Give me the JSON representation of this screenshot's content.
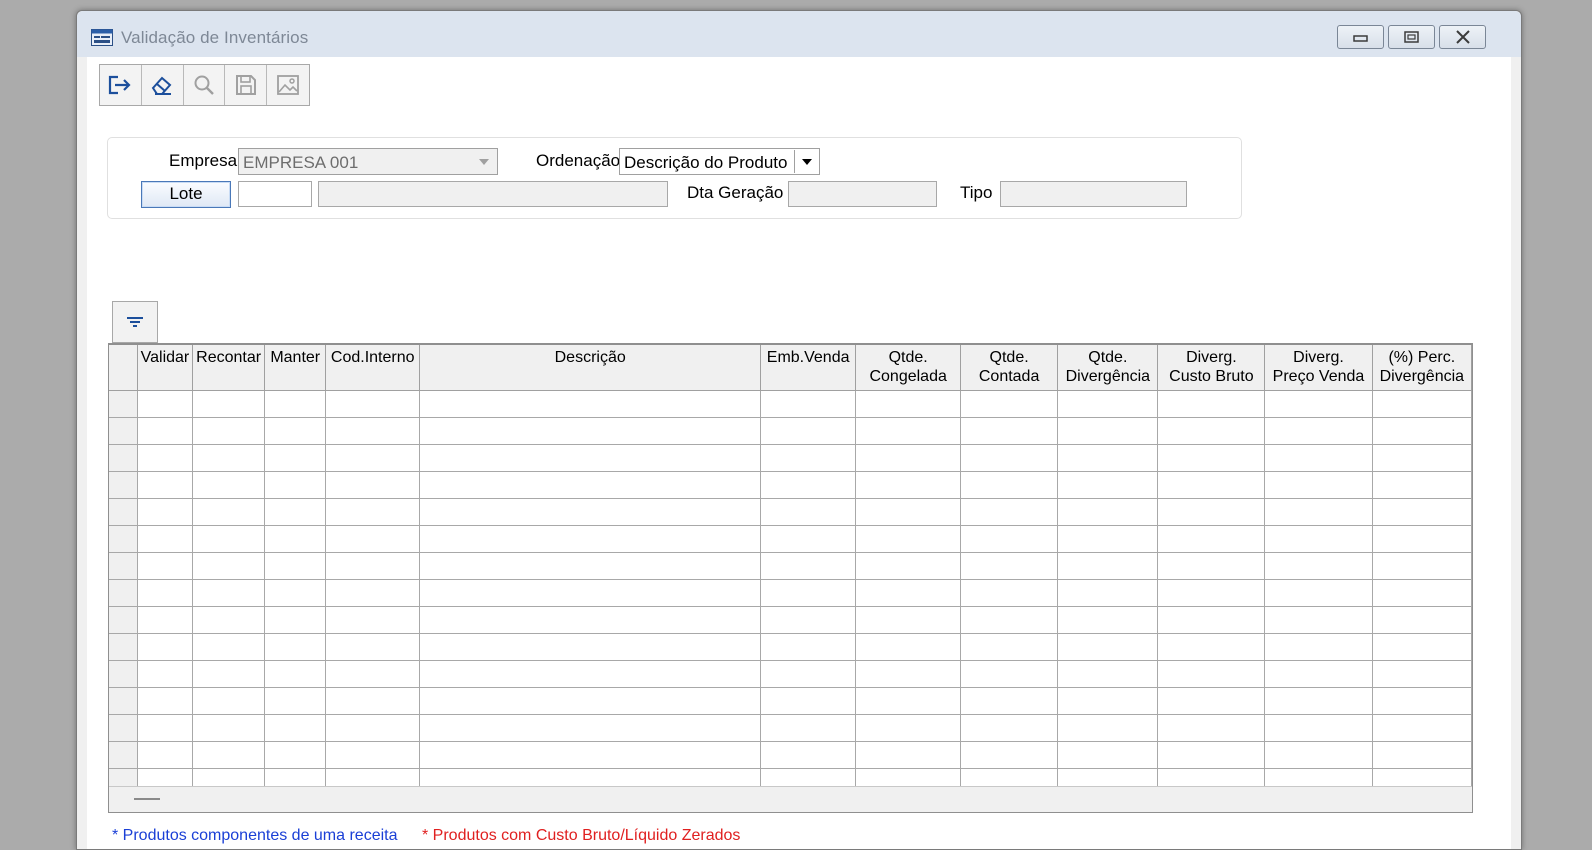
{
  "window": {
    "title": "Validação de Inventários",
    "icon": "form-window-icon",
    "controls": [
      "minimize-icon",
      "restore-icon",
      "close-icon"
    ]
  },
  "toolbar": {
    "buttons": [
      {
        "name": "exit-button",
        "icon": "exit-icon",
        "enabled": true
      },
      {
        "name": "clear-button",
        "icon": "eraser-icon",
        "enabled": true
      },
      {
        "name": "search-button",
        "icon": "search-icon",
        "enabled": false
      },
      {
        "name": "save-button",
        "icon": "save-icon",
        "enabled": false
      },
      {
        "name": "image-button",
        "icon": "image-icon",
        "enabled": false
      }
    ]
  },
  "filters": {
    "empresa_label": "Empresa",
    "empresa_value": "EMPRESA 001",
    "ordenacao_label": "Ordenação",
    "ordenacao_value": "Descrição do Produto",
    "lote_button": "Lote",
    "lote_code": "",
    "lote_description": "",
    "dta_geracao_label": "Dta Geração",
    "dta_geracao_value": "",
    "tipo_label": "Tipo",
    "tipo_value": ""
  },
  "grid": {
    "filter_icon": "filter-icon",
    "columns": [
      {
        "line1": "",
        "line2": ""
      },
      {
        "line1": "Validar",
        "line2": ""
      },
      {
        "line1": "Recontar",
        "line2": ""
      },
      {
        "line1": "Manter",
        "line2": ""
      },
      {
        "line1": "Cod.Interno",
        "line2": ""
      },
      {
        "line1": "Descrição",
        "line2": ""
      },
      {
        "line1": "Emb.Venda",
        "line2": ""
      },
      {
        "line1": "Qtde.",
        "line2": "Congelada"
      },
      {
        "line1": "Qtde.",
        "line2": "Contada"
      },
      {
        "line1": "Qtde.",
        "line2": "Divergência"
      },
      {
        "line1": "Diverg.",
        "line2": "Custo Bruto"
      },
      {
        "line1": "Diverg.",
        "line2": "Preço Venda"
      },
      {
        "line1": "(%) Perc.",
        "line2": "Divergência"
      }
    ],
    "empty_rows": 15
  },
  "legend": {
    "blue_note": "* Produtos componentes de uma receita",
    "red_note": "* Produtos com Custo Bruto/Líquido Zerados",
    "blue_color": "#1a3fd6",
    "red_color": "#e02020"
  }
}
